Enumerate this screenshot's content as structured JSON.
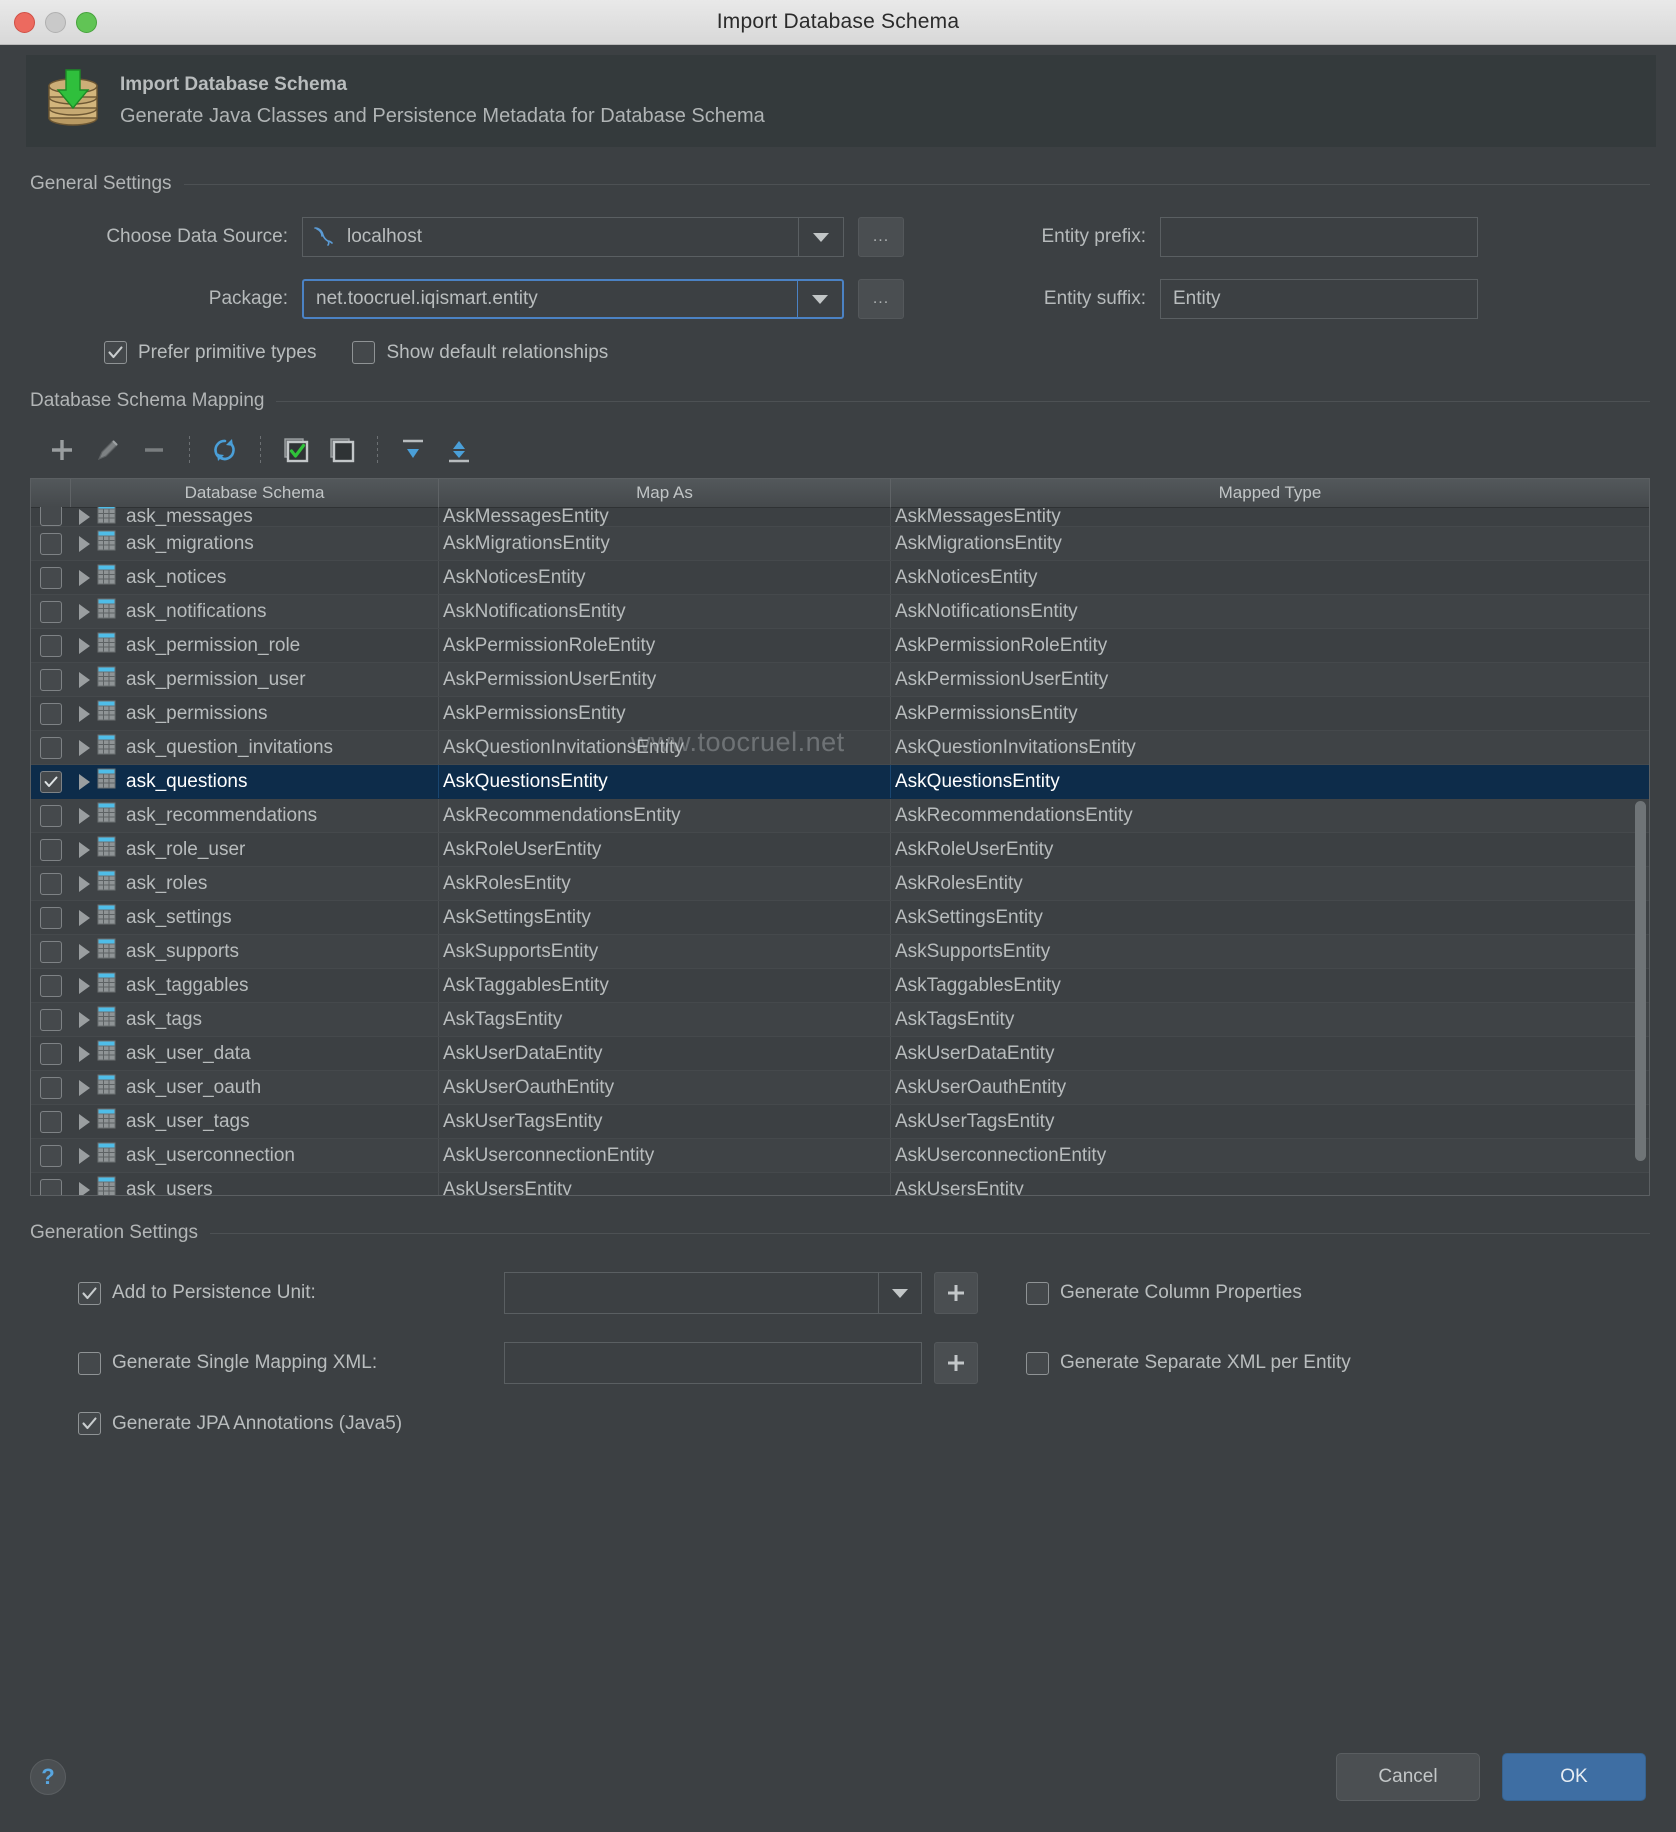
{
  "window": {
    "title": "Import Database Schema",
    "traffic_lights": [
      "close-dot",
      "minimize-dot",
      "zoom-dot"
    ]
  },
  "banner": {
    "icon": "database-import-icon",
    "title": "Import Database Schema",
    "subtitle": "Generate Java Classes and Persistence Metadata for Database Schema"
  },
  "general_settings": {
    "caption": "General Settings",
    "data_source": {
      "label": "Choose Data Source:",
      "value": "localhost",
      "icon": "mysql-dolphin-icon",
      "browse_label": "..."
    },
    "package": {
      "label": "Package:",
      "value": "net.toocruel.iqismart.entity",
      "browse_label": "..."
    },
    "entity_prefix": {
      "label": "Entity prefix:",
      "value": "",
      "placeholder": ""
    },
    "entity_suffix": {
      "label": "Entity suffix:",
      "value": "Entity",
      "placeholder": ""
    },
    "prefer_primitive_types": {
      "label": "Prefer primitive types",
      "checked": true
    },
    "show_default_relationships": {
      "label": "Show default relationships",
      "checked": false
    }
  },
  "mapping": {
    "caption": "Database Schema Mapping",
    "toolbar": [
      {
        "name": "add-button",
        "icon": "plus-icon",
        "label": "+"
      },
      {
        "name": "edit-button",
        "icon": "pencil-icon",
        "label": ""
      },
      {
        "name": "remove-button",
        "icon": "minus-icon",
        "label": "−"
      },
      {
        "name": "refresh-button",
        "icon": "refresh-icon",
        "label": ""
      },
      {
        "name": "select-all-button",
        "icon": "checkbox-checked-icon",
        "label": ""
      },
      {
        "name": "deselect-all-button",
        "icon": "checkbox-unchecked-icon",
        "label": ""
      },
      {
        "name": "expand-all-button",
        "icon": "expand-all-icon",
        "label": ""
      },
      {
        "name": "collapse-all-button",
        "icon": "collapse-all-icon",
        "label": ""
      }
    ],
    "columns": [
      "Database Schema",
      "Map As",
      "Mapped Type"
    ],
    "watermark": "www.toocruel.net",
    "rows": [
      {
        "schema": "ask_messages",
        "map_as": "AskMessagesEntity",
        "mapped_type": "AskMessagesEntity",
        "checked": false,
        "selected": false,
        "clipped": true
      },
      {
        "schema": "ask_migrations",
        "map_as": "AskMigrationsEntity",
        "mapped_type": "AskMigrationsEntity",
        "checked": false,
        "selected": false
      },
      {
        "schema": "ask_notices",
        "map_as": "AskNoticesEntity",
        "mapped_type": "AskNoticesEntity",
        "checked": false,
        "selected": false
      },
      {
        "schema": "ask_notifications",
        "map_as": "AskNotificationsEntity",
        "mapped_type": "AskNotificationsEntity",
        "checked": false,
        "selected": false
      },
      {
        "schema": "ask_permission_role",
        "map_as": "AskPermissionRoleEntity",
        "mapped_type": "AskPermissionRoleEntity",
        "checked": false,
        "selected": false
      },
      {
        "schema": "ask_permission_user",
        "map_as": "AskPermissionUserEntity",
        "mapped_type": "AskPermissionUserEntity",
        "checked": false,
        "selected": false
      },
      {
        "schema": "ask_permissions",
        "map_as": "AskPermissionsEntity",
        "mapped_type": "AskPermissionsEntity",
        "checked": false,
        "selected": false
      },
      {
        "schema": "ask_question_invitations",
        "map_as": "AskQuestionInvitationsEntity",
        "mapped_type": "AskQuestionInvitationsEntity",
        "checked": false,
        "selected": false
      },
      {
        "schema": "ask_questions",
        "map_as": "AskQuestionsEntity",
        "mapped_type": "AskQuestionsEntity",
        "checked": true,
        "selected": true
      },
      {
        "schema": "ask_recommendations",
        "map_as": "AskRecommendationsEntity",
        "mapped_type": "AskRecommendationsEntity",
        "checked": false,
        "selected": false
      },
      {
        "schema": "ask_role_user",
        "map_as": "AskRoleUserEntity",
        "mapped_type": "AskRoleUserEntity",
        "checked": false,
        "selected": false
      },
      {
        "schema": "ask_roles",
        "map_as": "AskRolesEntity",
        "mapped_type": "AskRolesEntity",
        "checked": false,
        "selected": false
      },
      {
        "schema": "ask_settings",
        "map_as": "AskSettingsEntity",
        "mapped_type": "AskSettingsEntity",
        "checked": false,
        "selected": false
      },
      {
        "schema": "ask_supports",
        "map_as": "AskSupportsEntity",
        "mapped_type": "AskSupportsEntity",
        "checked": false,
        "selected": false
      },
      {
        "schema": "ask_taggables",
        "map_as": "AskTaggablesEntity",
        "mapped_type": "AskTaggablesEntity",
        "checked": false,
        "selected": false
      },
      {
        "schema": "ask_tags",
        "map_as": "AskTagsEntity",
        "mapped_type": "AskTagsEntity",
        "checked": false,
        "selected": false
      },
      {
        "schema": "ask_user_data",
        "map_as": "AskUserDataEntity",
        "mapped_type": "AskUserDataEntity",
        "checked": false,
        "selected": false
      },
      {
        "schema": "ask_user_oauth",
        "map_as": "AskUserOauthEntity",
        "mapped_type": "AskUserOauthEntity",
        "checked": false,
        "selected": false
      },
      {
        "schema": "ask_user_tags",
        "map_as": "AskUserTagsEntity",
        "mapped_type": "AskUserTagsEntity",
        "checked": false,
        "selected": false
      },
      {
        "schema": "ask_userconnection",
        "map_as": "AskUserconnectionEntity",
        "mapped_type": "AskUserconnectionEntity",
        "checked": false,
        "selected": false
      },
      {
        "schema": "ask_users",
        "map_as": "AskUsersEntity",
        "mapped_type": "AskUsersEntity",
        "checked": false,
        "selected": false
      }
    ]
  },
  "generation_settings": {
    "caption": "Generation Settings",
    "add_to_persistence_unit": {
      "label": "Add to Persistence Unit:",
      "checked": true,
      "value": "",
      "add_label": "+"
    },
    "generate_single_mapping_xml": {
      "label": "Generate Single Mapping XML:",
      "checked": false,
      "value": "",
      "add_label": "+"
    },
    "generate_jpa_annotations": {
      "label": "Generate JPA Annotations (Java5)",
      "checked": true
    },
    "generate_column_properties": {
      "label": "Generate Column Properties",
      "checked": false
    },
    "generate_separate_xml_per_entity": {
      "label": "Generate Separate XML per Entity",
      "checked": false
    }
  },
  "footer": {
    "help_label": "?",
    "cancel_label": "Cancel",
    "ok_label": "OK"
  },
  "colors": {
    "accent": "#3e6ea3",
    "focus_border": "#4b82c4",
    "selection_bg": "#0d2c4a",
    "window_bg": "#3c4043",
    "banner_bg": "#343a3c",
    "check_green": "#3cc43c",
    "icon_blue": "#5b9bd5"
  }
}
